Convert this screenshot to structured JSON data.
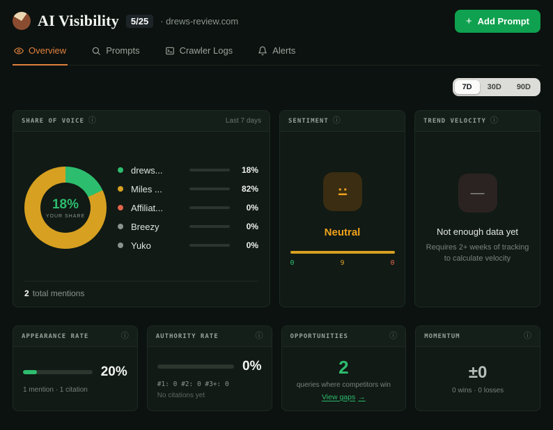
{
  "icons": {
    "plus": "+",
    "info": "ⓘ",
    "arrow_right": "→",
    "minus": "—"
  },
  "colors": {
    "green": "#2dbd6e",
    "gold": "#d7a021",
    "orange": "#e0813f",
    "amber": "#f0a21c",
    "red": "#e0644a",
    "gray": "#8a938e",
    "button_green": "#0fa14f"
  },
  "header": {
    "title": "AI Visibility",
    "quota_badge": "5/25",
    "domain": "· drews-review.com",
    "add_prompt_label": "Add Prompt"
  },
  "tabs": [
    {
      "label": "Overview"
    },
    {
      "label": "Prompts"
    },
    {
      "label": "Crawler Logs"
    },
    {
      "label": "Alerts"
    }
  ],
  "range": {
    "options": [
      "7D",
      "30D",
      "90D"
    ],
    "selected": "7D"
  },
  "share_of_voice": {
    "label": "SHARE OF VOICE",
    "period": "Last 7 days",
    "your_share_pct": 18,
    "center_value": "18%",
    "center_caption": "YOUR SHARE",
    "legend": [
      {
        "name": "drews...",
        "pct": 18,
        "pct_label": "18%",
        "color": "#2dbd6e"
      },
      {
        "name": "Miles ...",
        "pct": 82,
        "pct_label": "82%",
        "color": "#d7a021"
      },
      {
        "name": "Affiliat...",
        "pct": 0,
        "pct_label": "0%",
        "color": "#e0644a"
      },
      {
        "name": "Breezy",
        "pct": 0,
        "pct_label": "0%",
        "color": "#8a938e"
      },
      {
        "name": "Yuko",
        "pct": 0,
        "pct_label": "0%",
        "color": "#8a938e"
      }
    ],
    "total_value": "2",
    "total_caption": "total mentions"
  },
  "sentiment": {
    "label": "SENTIMENT",
    "value": "Neutral",
    "counts": {
      "positive": "0",
      "neutral": "9",
      "negative": "0"
    }
  },
  "trend_velocity": {
    "label": "TREND VELOCITY",
    "title": "Not enough data yet",
    "description": "Requires 2+ weeks of tracking to calculate velocity"
  },
  "appearance_rate": {
    "label": "APPEARANCE RATE",
    "pct": 20,
    "pct_label": "20%",
    "sub": "1 mention · 1 citation"
  },
  "authority_rate": {
    "label": "AUTHORITY RATE",
    "pct": 0,
    "pct_label": "0%",
    "ranks": "#1: 0 #2: 0 #3+: 0",
    "sub": "No citations yet"
  },
  "opportunities": {
    "label": "OPPORTUNITIES",
    "value": "2",
    "description": "queries where competitors win",
    "link_label": "View gaps"
  },
  "momentum": {
    "label": "MOMENTUM",
    "value": "±0",
    "sub": "0 wins · 0 losses"
  }
}
